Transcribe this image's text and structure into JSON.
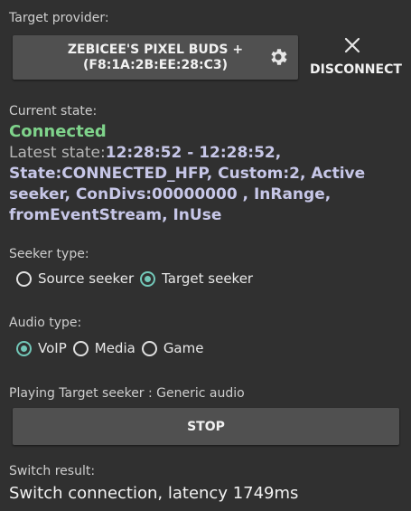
{
  "provider": {
    "label": "Target provider:",
    "device_name": "ZEBICEE'S PIXEL BUDS +\n(F8:1A:2B:EE:28:C3)",
    "settings_icon": "gear-icon",
    "close_icon": "close-icon",
    "disconnect_label": "DISCONNECT"
  },
  "state": {
    "label": "Current state:",
    "value": "Connected",
    "latest_prefix": "Latest state:",
    "latest_value": "12:28:52 - 12:28:52, State:CONNECTED_HFP, Custom:2, Active seeker, ConDivs:00000000 , InRange, fromEventStream, InUse"
  },
  "seeker": {
    "label": "Seeker type:",
    "options": [
      {
        "label": "Source seeker",
        "selected": false
      },
      {
        "label": "Target seeker",
        "selected": true
      }
    ]
  },
  "audio": {
    "label": "Audio type:",
    "options": [
      {
        "label": "VoIP",
        "selected": true
      },
      {
        "label": "Media",
        "selected": false
      },
      {
        "label": "Game",
        "selected": false
      }
    ]
  },
  "playing": {
    "text": "Playing Target seeker : Generic audio",
    "stop_label": "STOP"
  },
  "switch": {
    "label": "Switch result:",
    "value": "Switch connection, latency 1749ms"
  },
  "colors": {
    "background": "#303030",
    "connected": "#7fd38b",
    "latest_state": "#c7c7e8",
    "accent": "#72c7b8",
    "button": "#505050"
  }
}
